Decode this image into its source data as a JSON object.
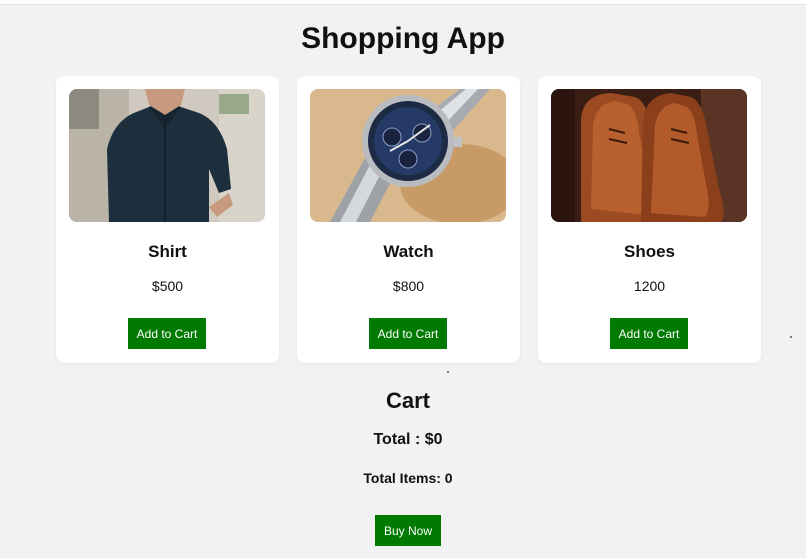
{
  "app": {
    "title": "Shopping App"
  },
  "products": [
    {
      "name": "Shirt",
      "price": "$500",
      "button": "Add to Cart",
      "image": "shirt-photo"
    },
    {
      "name": "Watch",
      "price": "$800",
      "button": "Add to Cart",
      "image": "watch-photo"
    },
    {
      "name": "Shoes",
      "price": "1200",
      "button": "Add to Cart",
      "image": "shoes-photo"
    }
  ],
  "cart": {
    "title": "Cart",
    "total": "Total : $0",
    "items": "Total Items: 0",
    "buy_label": "Buy Now"
  },
  "colors": {
    "button": "#007a00",
    "background": "#f2f2f2",
    "card": "#ffffff"
  }
}
